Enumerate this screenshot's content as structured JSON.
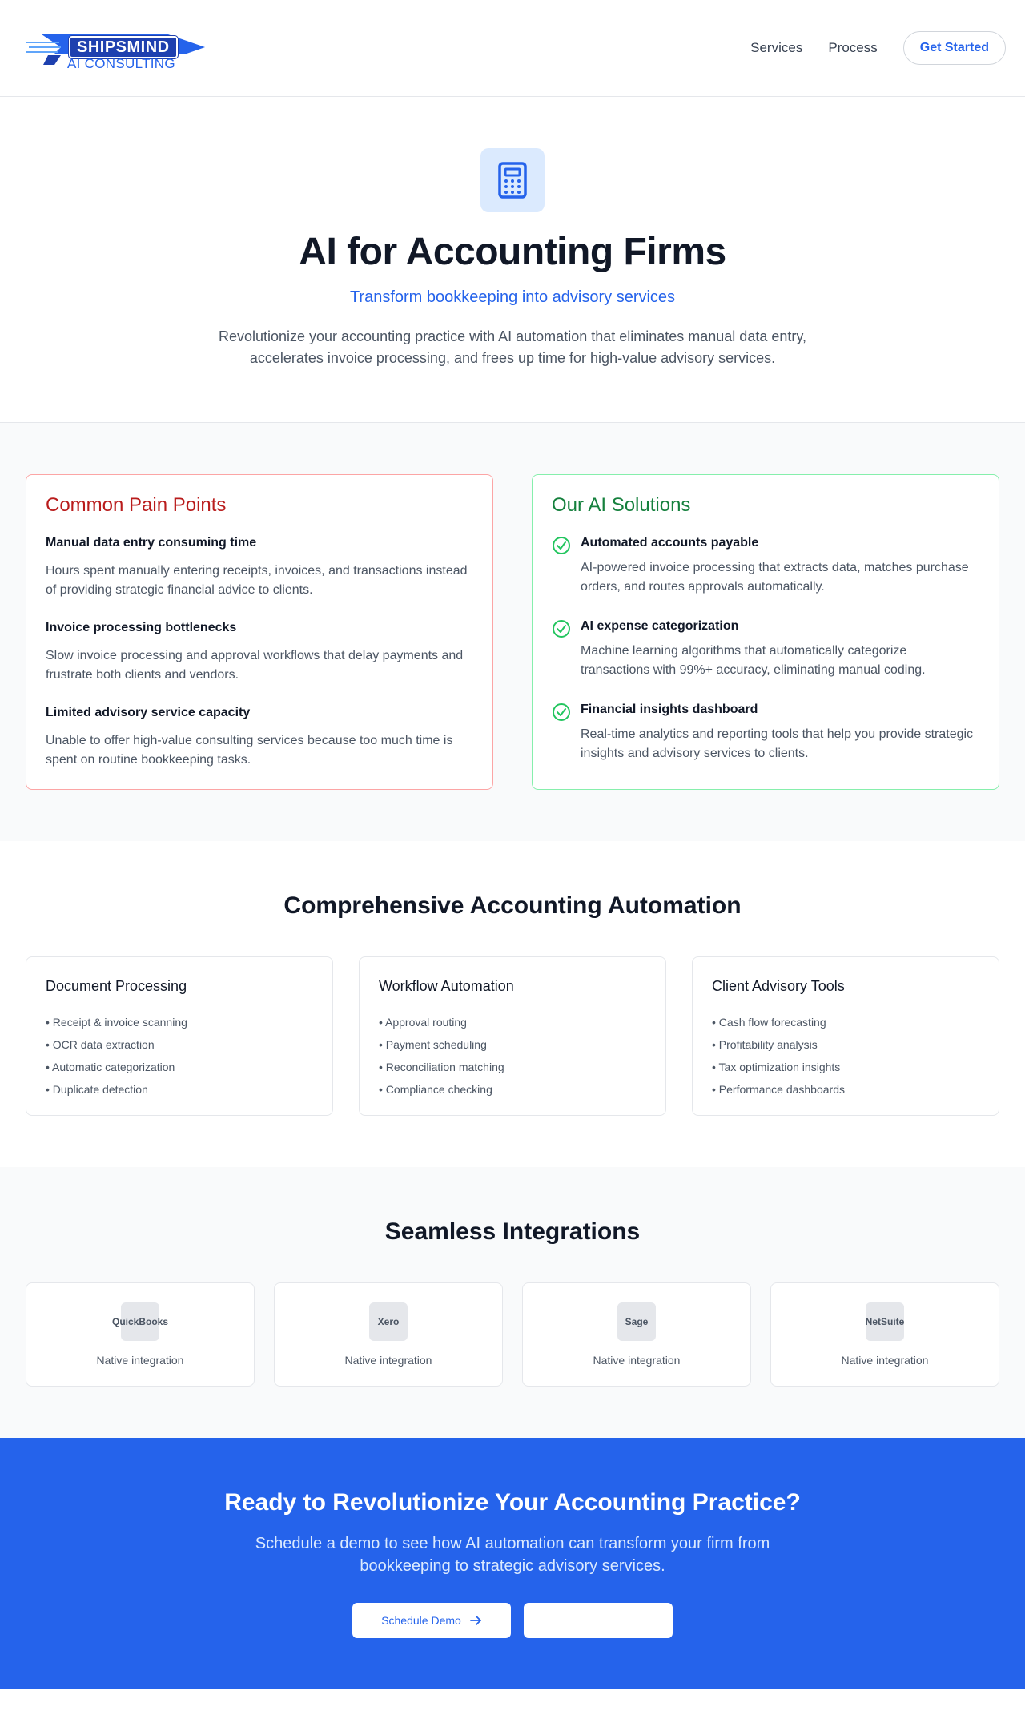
{
  "header": {
    "logo_top": "SHIPSMIND",
    "logo_bottom": "AI CONSULTING",
    "nav": [
      "Services",
      "Process"
    ],
    "cta_label": "Get Started"
  },
  "hero": {
    "icon": "calculator-icon",
    "title": "AI for Accounting Firms",
    "subtitle": "Transform bookkeeping into advisory services",
    "description": "Revolutionize your accounting practice with AI automation that eliminates manual data entry, accelerates invoice processing, and frees up time for high-value advisory services."
  },
  "pain": {
    "title": "Common Pain Points",
    "items": [
      {
        "title": "Manual data entry consuming time",
        "text": "Hours spent manually entering receipts, invoices, and transactions instead of providing strategic financial advice to clients."
      },
      {
        "title": "Invoice processing bottlenecks",
        "text": "Slow invoice processing and approval workflows that delay payments and frustrate both clients and vendors."
      },
      {
        "title": "Limited advisory service capacity",
        "text": "Unable to offer high-value consulting services because too much time is spent on routine bookkeeping tasks."
      }
    ]
  },
  "solutions": {
    "title": "Our AI Solutions",
    "items": [
      {
        "title": "Automated accounts payable",
        "text": "AI-powered invoice processing that extracts data, matches purchase orders, and routes approvals automatically."
      },
      {
        "title": "AI expense categorization",
        "text": "Machine learning algorithms that automatically categorize transactions with 99%+ accuracy, eliminating manual coding."
      },
      {
        "title": "Financial insights dashboard",
        "text": "Real-time analytics and reporting tools that help you provide strategic insights and advisory services to clients."
      }
    ]
  },
  "automation": {
    "title": "Comprehensive Accounting Automation",
    "cards": [
      {
        "title": "Document Processing",
        "items": [
          "• Receipt & invoice scanning",
          "• OCR data extraction",
          "• Automatic categorization",
          "• Duplicate detection"
        ]
      },
      {
        "title": "Workflow Automation",
        "items": [
          "• Approval routing",
          "• Payment scheduling",
          "• Reconciliation matching",
          "• Compliance checking"
        ]
      },
      {
        "title": "Client Advisory Tools",
        "items": [
          "• Cash flow forecasting",
          "• Profitability analysis",
          "• Tax optimization insights",
          "• Performance dashboards"
        ]
      }
    ]
  },
  "integrations": {
    "title": "Seamless Integrations",
    "items": [
      {
        "name": "QuickBooks",
        "caption": "Native integration"
      },
      {
        "name": "Xero",
        "caption": "Native integration"
      },
      {
        "name": "Sage",
        "caption": "Native integration"
      },
      {
        "name": "NetSuite",
        "caption": "Native integration"
      }
    ]
  },
  "cta": {
    "title": "Ready to Revolutionize Your Accounting Practice?",
    "text": "Schedule a demo to see how AI automation can transform your firm from bookkeeping to strategic advisory services.",
    "primary_label": "Schedule Demo",
    "secondary_label": ""
  },
  "colors": {
    "accent": "#2563eb",
    "pain": "#b91c1c",
    "solution": "#15803d"
  }
}
